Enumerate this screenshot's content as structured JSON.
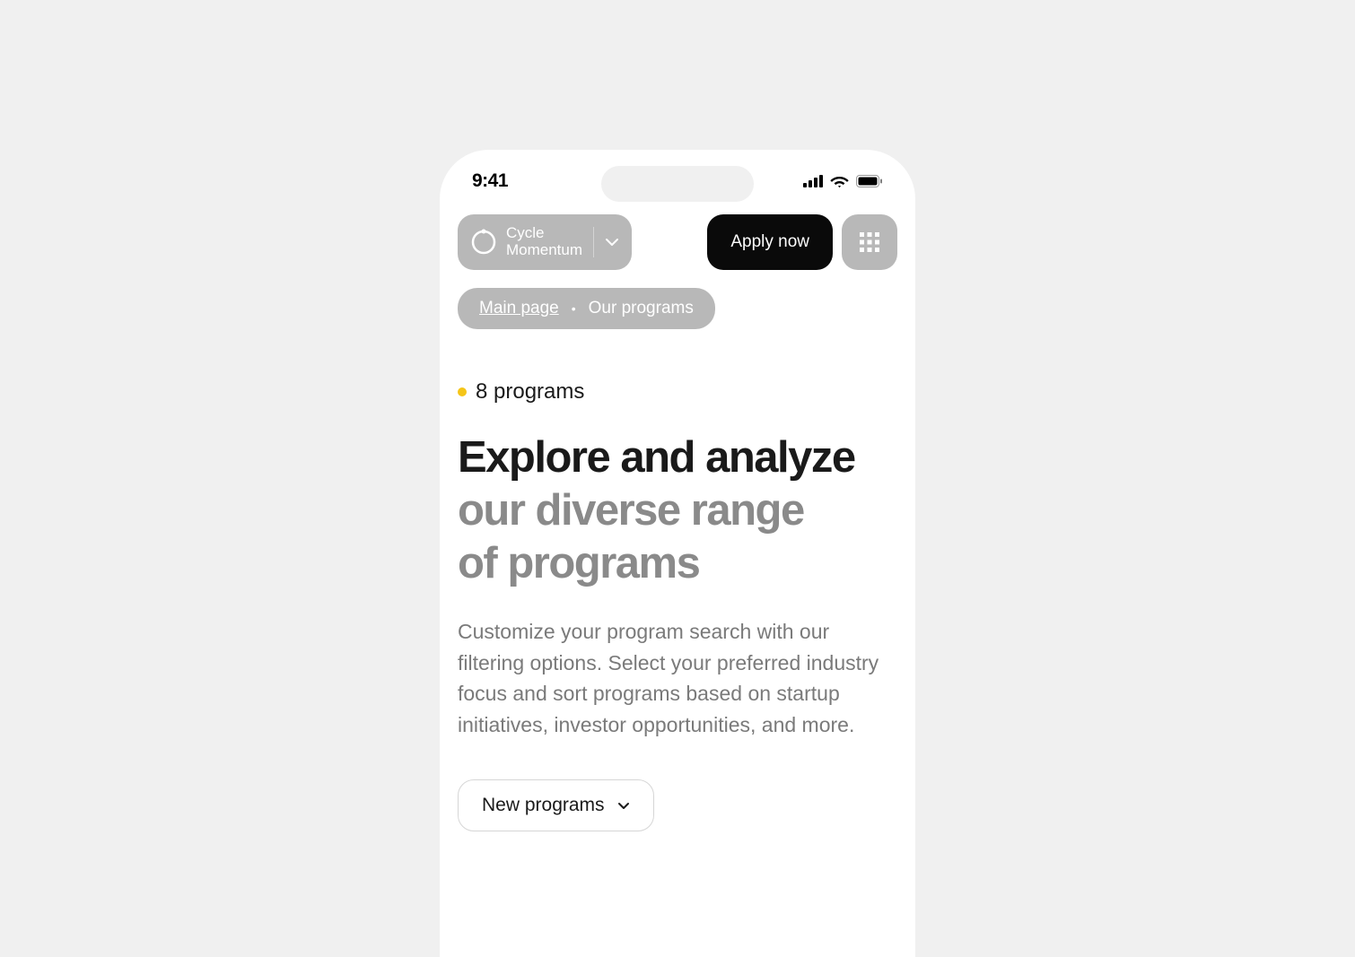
{
  "statusBar": {
    "time": "9:41"
  },
  "header": {
    "brand": {
      "line1": "Cycle",
      "line2": "Momentum"
    },
    "applyLabel": "Apply now"
  },
  "breadcrumb": {
    "home": "Main page",
    "current": "Our programs"
  },
  "content": {
    "countLabel": "8 programs",
    "headingDark": "Explore and analyze",
    "headingGray1": "our diverse range",
    "headingGray2": "of programs",
    "description": "Customize your program search with our filtering options. Select your preferred industry focus and sort programs based on startup initiatives, investor opportunities, and more.",
    "filterLabel": "New programs"
  }
}
